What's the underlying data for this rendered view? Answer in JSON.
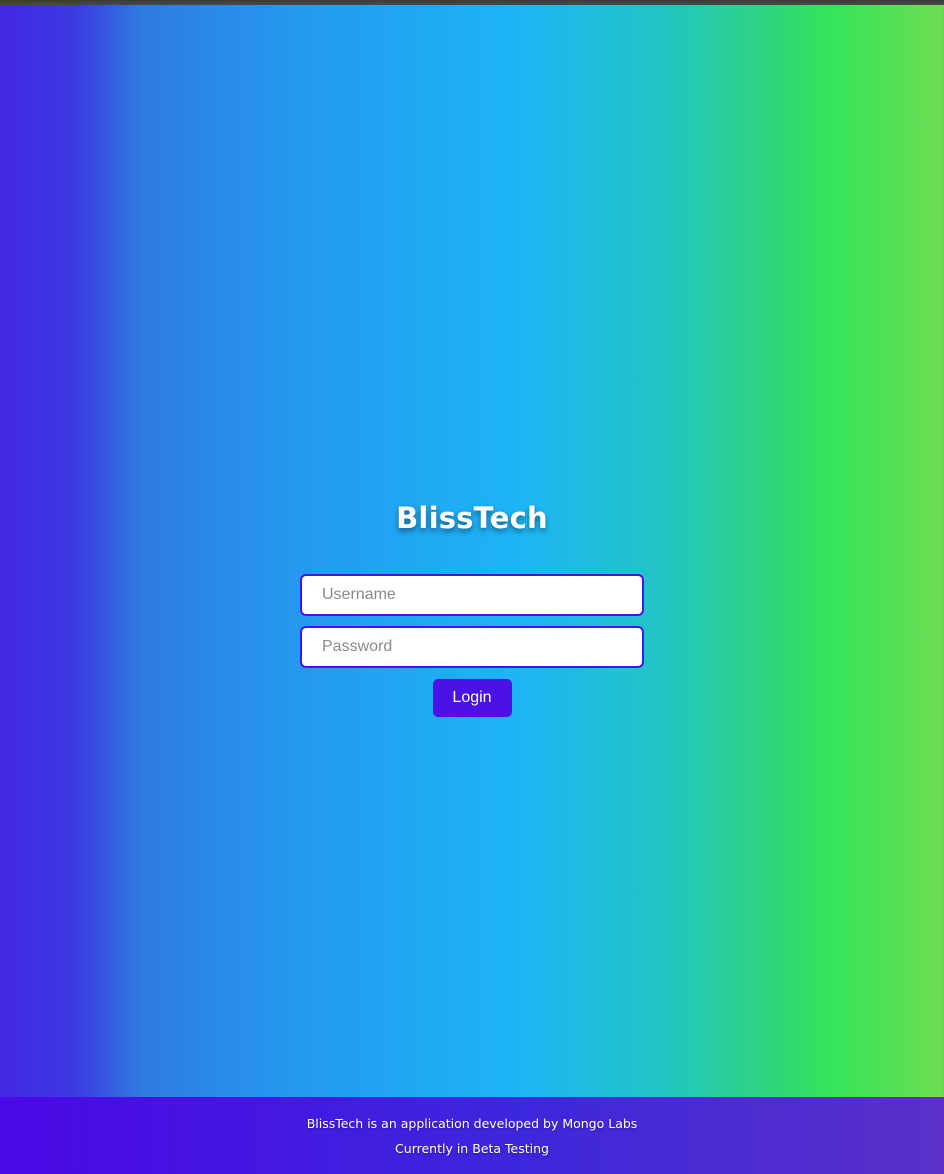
{
  "brand": {
    "title": "BlissTech"
  },
  "login_form": {
    "username_placeholder": "Username",
    "password_placeholder": "Password",
    "login_label": "Login"
  },
  "footer": {
    "line1": "BlissTech is an application developed by Mongo Labs",
    "line2": "Currently in Beta Testing"
  },
  "colors": {
    "accent": "#4a12e6",
    "gradient_left": "#4328e3",
    "gradient_mid": "#1db5f6",
    "gradient_right": "#6fdc52"
  }
}
